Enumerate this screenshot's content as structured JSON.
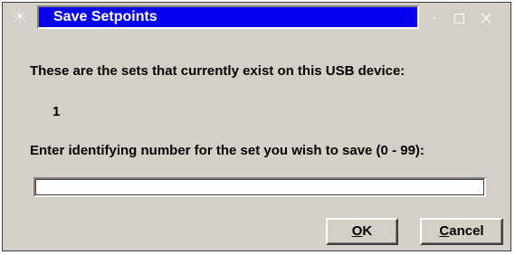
{
  "window": {
    "title": "Save Setpoints",
    "app_icon": "asterisk-icon",
    "controls": [
      "minimize-icon",
      "maximize-icon",
      "close-icon"
    ],
    "title_color": "#0a00f0",
    "background_color": "#d4d0c8"
  },
  "dialog": {
    "existing_sets_label": "These are the sets that currently exist on this USB device:",
    "existing_sets_value": "1",
    "enter_label": "Enter identifying number for the set you wish to save (0 - 99):",
    "set_number_value": "",
    "set_number_placeholder": ""
  },
  "buttons": {
    "ok": {
      "mnemonic": "O",
      "rest": "K"
    },
    "cancel": {
      "mnemonic": "C",
      "rest": "ancel"
    }
  }
}
